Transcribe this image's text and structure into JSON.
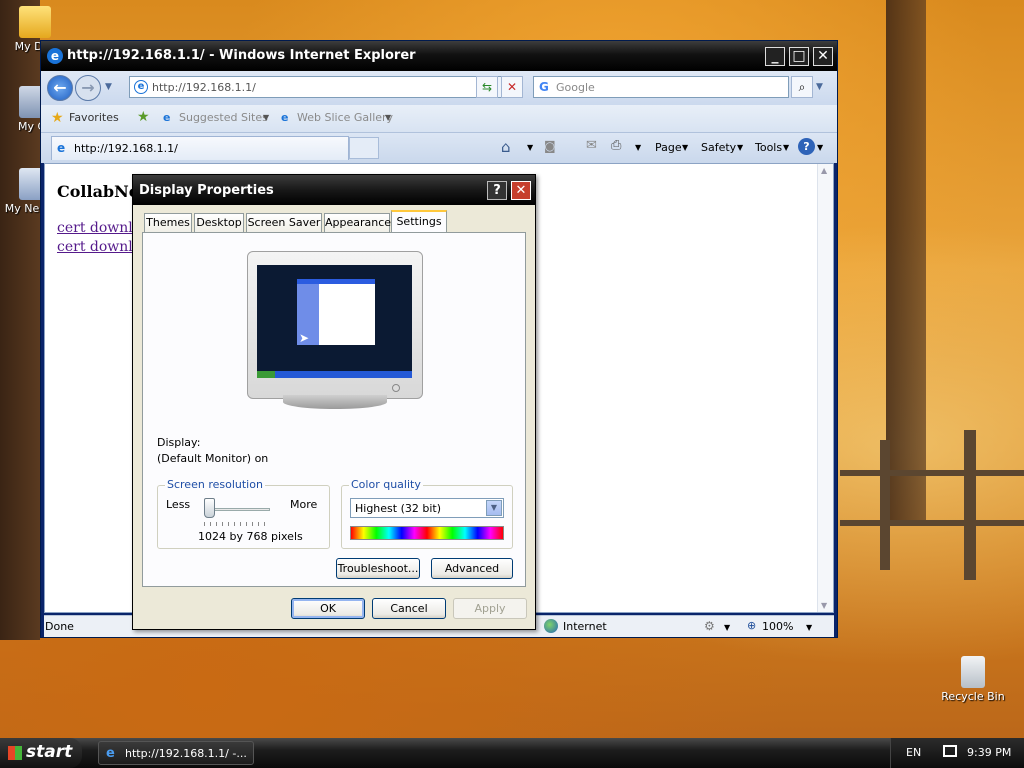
{
  "desktop": {
    "icons": [
      {
        "label": "My Doc"
      },
      {
        "label": "My Co"
      },
      {
        "label": "My Ne Plac"
      },
      {
        "label": "Recycle Bin"
      }
    ]
  },
  "ie": {
    "title": "http://192.168.1.1/ - Windows Internet Explorer",
    "address": "http://192.168.1.1/",
    "search_placeholder": "Google",
    "favorites": {
      "favorites_label": "Favorites",
      "suggested_sites": "Suggested Sites",
      "web_slice_gallery": "Web Slice Gallery"
    },
    "tab_title": "http://192.168.1.1/",
    "commands": {
      "page": "Page",
      "safety": "Safety",
      "tools": "Tools"
    },
    "content": {
      "heading": "CollabNet",
      "links": [
        "cert downloa",
        "cert downloa"
      ]
    },
    "status": {
      "text": "Done",
      "zone": "Internet",
      "zoom": "100%"
    }
  },
  "dialog": {
    "title": "Display Properties",
    "tabs": [
      {
        "label": "Themes"
      },
      {
        "label": "Desktop"
      },
      {
        "label": "Screen Saver"
      },
      {
        "label": "Appearance"
      },
      {
        "label": "Settings"
      }
    ],
    "active_tab": "Settings",
    "display_label": "Display:",
    "display_value": "(Default Monitor) on",
    "resolution": {
      "legend": "Screen resolution",
      "less": "Less",
      "more": "More",
      "value": "1024 by 768 pixels",
      "slider_position": 0.0
    },
    "color_quality": {
      "legend": "Color quality",
      "selected": "Highest (32 bit)"
    },
    "buttons": {
      "troubleshoot": "Troubleshoot...",
      "advanced": "Advanced",
      "ok": "OK",
      "cancel": "Cancel",
      "apply": "Apply"
    }
  },
  "taskbar": {
    "start": "start",
    "task_label": "http://192.168.1.1/ -...",
    "language": "EN",
    "time": "9:39 PM"
  }
}
